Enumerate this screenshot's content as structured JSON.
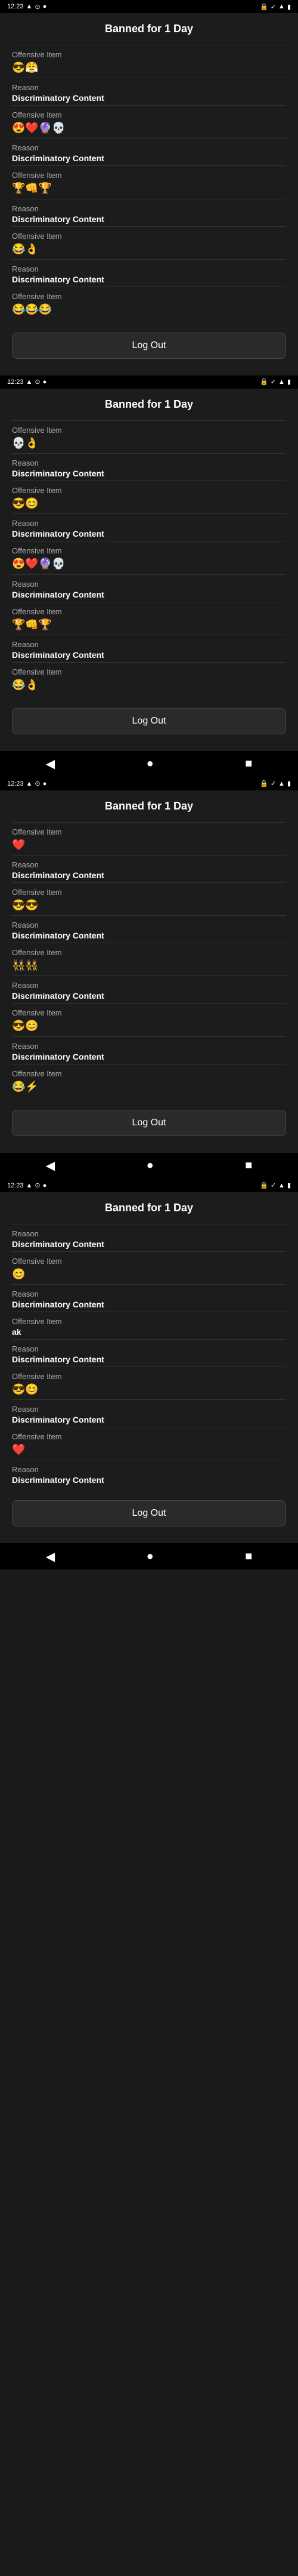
{
  "screens": [
    {
      "id": "screen1",
      "title": "Banned for 1 Day",
      "status_time": "12:23",
      "status_left_icons": [
        "signal",
        "wifi",
        "circle"
      ],
      "status_right_icons": [
        "shield",
        "check",
        "wifi-signal",
        "battery"
      ],
      "items": [
        {
          "label": "Offensive Item",
          "value": "😎😤",
          "type": "emoji"
        },
        {
          "label": "Reason",
          "value": "Discriminatory Content",
          "type": "text"
        },
        {
          "label": "Offensive Item",
          "value": "😍❤️🔮💀",
          "type": "emoji"
        },
        {
          "label": "Reason",
          "value": "Discriminatory Content",
          "type": "text"
        },
        {
          "label": "Offensive Item",
          "value": "🏆👊🏆",
          "type": "emoji"
        },
        {
          "label": "Reason",
          "value": "Discriminatory Content",
          "type": "text"
        },
        {
          "label": "Offensive Item",
          "value": "😂👌",
          "type": "emoji"
        },
        {
          "label": "Reason",
          "value": "Discriminatory Content",
          "type": "text"
        },
        {
          "label": "Offensive Item",
          "value": "😂😂😂",
          "type": "emoji"
        }
      ],
      "logout_label": "Log Out",
      "show_nav": false
    },
    {
      "id": "screen2",
      "title": "Banned for 1 Day",
      "status_time": "12:23",
      "items": [
        {
          "label": "Offensive Item",
          "value": "💀👌",
          "type": "emoji"
        },
        {
          "label": "Reason",
          "value": "Discriminatory Content",
          "type": "text"
        },
        {
          "label": "Offensive Item",
          "value": "😎😊",
          "type": "emoji"
        },
        {
          "label": "Reason",
          "value": "Discriminatory Content",
          "type": "text"
        },
        {
          "label": "Offensive Item",
          "value": "😍❤️🔮💀",
          "type": "emoji"
        },
        {
          "label": "Reason",
          "value": "Discriminatory Content",
          "type": "text"
        },
        {
          "label": "Offensive Item",
          "value": "🏆👊🏆",
          "type": "emoji"
        },
        {
          "label": "Reason",
          "value": "Discriminatory Content",
          "type": "text"
        },
        {
          "label": "Offensive Item",
          "value": "😂👌",
          "type": "emoji"
        }
      ],
      "logout_label": "Log Out",
      "show_nav": true
    },
    {
      "id": "screen3",
      "title": "Banned for 1 Day",
      "status_time": "12:23",
      "items": [
        {
          "label": "Offensive Item",
          "value": "❤️",
          "type": "emoji"
        },
        {
          "label": "Reason",
          "value": "Discriminatory Content",
          "type": "text"
        },
        {
          "label": "Offensive Item",
          "value": "😎😎",
          "type": "emoji"
        },
        {
          "label": "Reason",
          "value": "Discriminatory Content",
          "type": "text"
        },
        {
          "label": "Offensive Item",
          "value": "👯👯",
          "type": "emoji"
        },
        {
          "label": "Reason",
          "value": "Discriminatory Content",
          "type": "text"
        },
        {
          "label": "Offensive Item",
          "value": "😎😊",
          "type": "emoji"
        },
        {
          "label": "Reason",
          "value": "Discriminatory Content",
          "type": "text"
        },
        {
          "label": "Offensive Item",
          "value": "😂⚡",
          "type": "emoji"
        }
      ],
      "logout_label": "Log Out",
      "show_nav": true
    },
    {
      "id": "screen4",
      "title": "Banned for 1 Day",
      "status_time": "12:23",
      "items": [
        {
          "label": "Reason",
          "value": "Discriminatory Content",
          "type": "text"
        },
        {
          "label": "Offensive Item",
          "value": "😊",
          "type": "emoji"
        },
        {
          "label": "Reason",
          "value": "Discriminatory Content",
          "type": "text"
        },
        {
          "label": "Offensive Item",
          "value": "ak",
          "type": "text_val"
        },
        {
          "label": "Reason",
          "value": "Discriminatory Content",
          "type": "text"
        },
        {
          "label": "Offensive Item",
          "value": "😎😊",
          "type": "emoji"
        },
        {
          "label": "Reason",
          "value": "Discriminatory Content",
          "type": "text"
        },
        {
          "label": "Offensive Item",
          "value": "❤️",
          "type": "emoji"
        },
        {
          "label": "Reason",
          "value": "Discriminatory Content",
          "type": "text"
        }
      ],
      "logout_label": "Log Out",
      "show_nav": true
    }
  ]
}
